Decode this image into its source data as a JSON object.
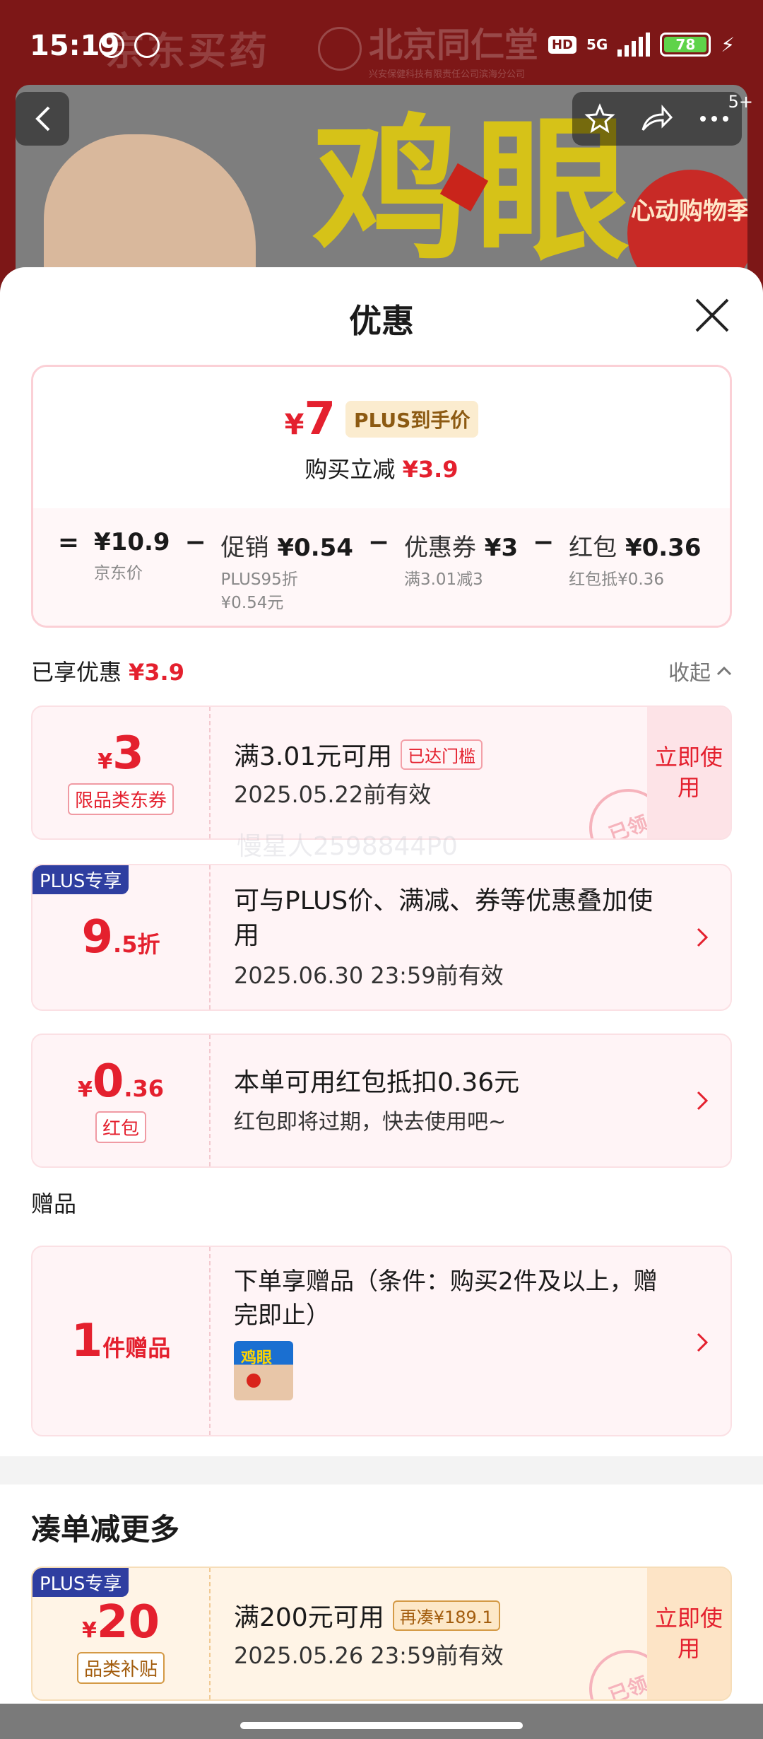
{
  "status": {
    "time": "15:19",
    "hd": "HD",
    "network": "5G",
    "battery": "78"
  },
  "background": {
    "banner_text": "京东买药",
    "brand_name": "北京同仁堂",
    "brand_sub": "兴安保健科技有限责任公司滨海分公司",
    "product_text": "鸡眼",
    "promo": "心动购物季",
    "nav_badge": "5+"
  },
  "sheet": {
    "title": "优惠",
    "summary": {
      "final_price_symbol": "¥",
      "final_price": "7",
      "plus_tag": "PLUS到手价",
      "reduce_label": "购买立减",
      "reduce_amount": "¥3.9",
      "formula": [
        {
          "op": "=",
          "label": "",
          "value": "¥10.9",
          "sub": "京东价"
        },
        {
          "op": "−",
          "label": "促销",
          "value": "¥0.54",
          "sub": "PLUS95折\n¥0.54元"
        },
        {
          "op": "−",
          "label": "优惠券",
          "value": "¥3",
          "sub": "满3.01减3"
        },
        {
          "op": "−",
          "label": "红包",
          "value": "¥0.36",
          "sub": "红包抵¥0.36"
        }
      ]
    },
    "enjoyed": {
      "label": "已享优惠",
      "amount": "¥3.9",
      "collapse": "收起"
    },
    "coupons": {
      "c1": {
        "symbol": "¥",
        "value": "3",
        "type": "限品类东券",
        "condition": "满3.01元可用",
        "tag": "已达门槛",
        "expiry": "2025.05.22前有效",
        "action": "立即使用",
        "stamp": "已领"
      },
      "c2": {
        "plus": "PLUS专享",
        "value_int": "9",
        "value_frac": ".5折",
        "desc": "可与PLUS价、满减、券等优惠叠加使用",
        "expiry": "2025.06.30 23:59前有效"
      },
      "c3": {
        "symbol": "¥",
        "value_int": "0",
        "value_frac": ".36",
        "type": "红包",
        "desc": "本单可用红包抵扣0.36元",
        "sub": "红包即将过期，快去使用吧~"
      }
    },
    "gift": {
      "section": "赠品",
      "count": "1",
      "unit": "件赠品",
      "desc": "下单享赠品（条件：购买2件及以上，赠完即止）",
      "thumb_text": "鸡眼"
    },
    "watermark": "慢星人2598844P0",
    "more": {
      "title": "凑单减更多",
      "coupon": {
        "plus": "PLUS专享",
        "symbol": "¥",
        "value": "20",
        "type": "品类补贴",
        "condition": "满200元可用",
        "tag": "再凑¥189.1",
        "expiry": "2025.05.26 23:59前有效",
        "action": "立即使用",
        "stamp": "已领"
      }
    }
  },
  "colors": {
    "accent_red": "#e4202e",
    "plus_blue": "#2f3ea0",
    "header_bg": "#7d1717"
  }
}
